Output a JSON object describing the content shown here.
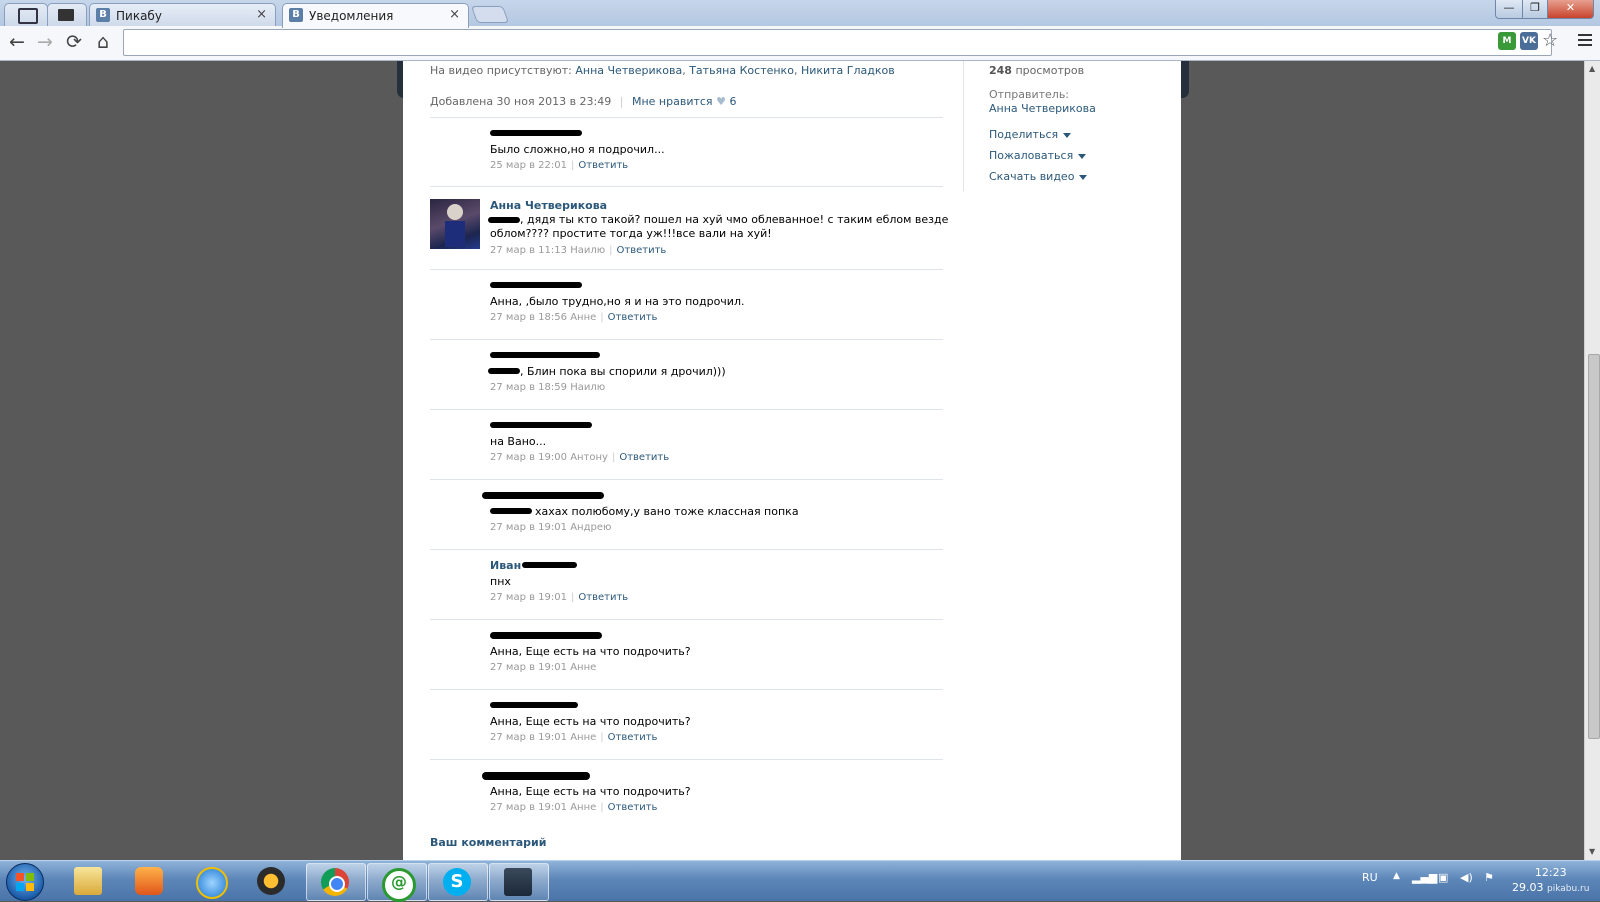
{
  "browser": {
    "tabs": [
      {
        "favicon": "В",
        "title": "Пикабу"
      },
      {
        "favicon": "В",
        "title": "Уведомления"
      }
    ],
    "close_glyph": "×",
    "window_controls": {
      "minimize": "—",
      "restore": "❐",
      "close": "✕"
    },
    "nav": {
      "back": "←",
      "forward": "→",
      "reload": "⟳",
      "home": "⌂"
    },
    "address": "",
    "extensions": [
      {
        "icon": "ext-shield-icon",
        "label": "M",
        "color": "#3a9a3a"
      },
      {
        "icon": "vk-extension-icon",
        "label": "VK",
        "color": "#4a6e98"
      }
    ],
    "star": "☆"
  },
  "video": {
    "presence_label": "На видео присутствуют:",
    "people": [
      "Анна Четверикова",
      "Татьяна Костенко",
      "Никита Гладков"
    ],
    "added": "Добавлена 30 ноя 2013 в 23:49",
    "like_label": "Мне нравится",
    "heart": "♥",
    "likes": "6",
    "views_count": "248",
    "views_label": "просмотров",
    "sender_label": "Отправитель:",
    "sender": "Анна Четверикова",
    "actions": [
      "Поделиться",
      "Пожаловаться",
      "Скачать видео"
    ]
  },
  "comments": [
    {
      "name": "",
      "text": "Было сложно,но я подрочил...",
      "date": "25 мар в 22:01",
      "to": "",
      "reply": "Ответить"
    },
    {
      "name": "Анна Четверикова",
      "text": ", дядя ты кто такой? пошел на хуй чмо облеванное! с таким еблом везде",
      "text2": "облом???? простите тогда уж!!!все вали на хуй!",
      "date": "27 мар в 11:13",
      "to": "Наилю",
      "reply": "Ответить"
    },
    {
      "name": "",
      "text": "Анна, ,было трудно,но я и на это подрочил.",
      "date": "27 мар в 18:56",
      "to": "Анне",
      "reply": "Ответить"
    },
    {
      "name": "",
      "text": ", Блин пока вы спорили я дрочил)))",
      "date": "27 мар в 18:59",
      "to": "Наилю",
      "reply": ""
    },
    {
      "name": "",
      "text": "на Вано...",
      "date": "27 мар в 19:00",
      "to": "Антону",
      "reply": "Ответить"
    },
    {
      "name": "",
      "text": "хахах полюбому,у вано тоже классная попка",
      "date": "27 мар в 19:01",
      "to": "Андрею",
      "reply": ""
    },
    {
      "name": "Иван",
      "text": "пнх",
      "date": "27 мар в 19:01",
      "to": "",
      "reply": "Ответить"
    },
    {
      "name": "",
      "text": "Анна, Еще есть на что подрочить?",
      "date": "27 мар в 19:01",
      "to": "Анне",
      "reply": ""
    },
    {
      "name": "",
      "text": "Анна, Еще есть на что подрочить?",
      "date": "27 мар в 19:01",
      "to": "Анне",
      "reply": "Ответить"
    },
    {
      "name": "",
      "text": "Анна, Еще есть на что подрочить?",
      "date": "27 мар в 19:01",
      "to": "Анне",
      "reply": "Ответить"
    }
  ],
  "your_comment": "Ваш комментарий",
  "taskbar": {
    "apps": [
      "windows-explorer-icon",
      "media-player-icon",
      "internet-explorer-icon",
      "aimp-icon",
      "chrome-icon",
      "mail-agent-icon",
      "skype-icon",
      "steam-icon"
    ],
    "lang": "RU",
    "time": "12:23",
    "date": "29.03",
    "watermark": "pikabu.ru"
  }
}
